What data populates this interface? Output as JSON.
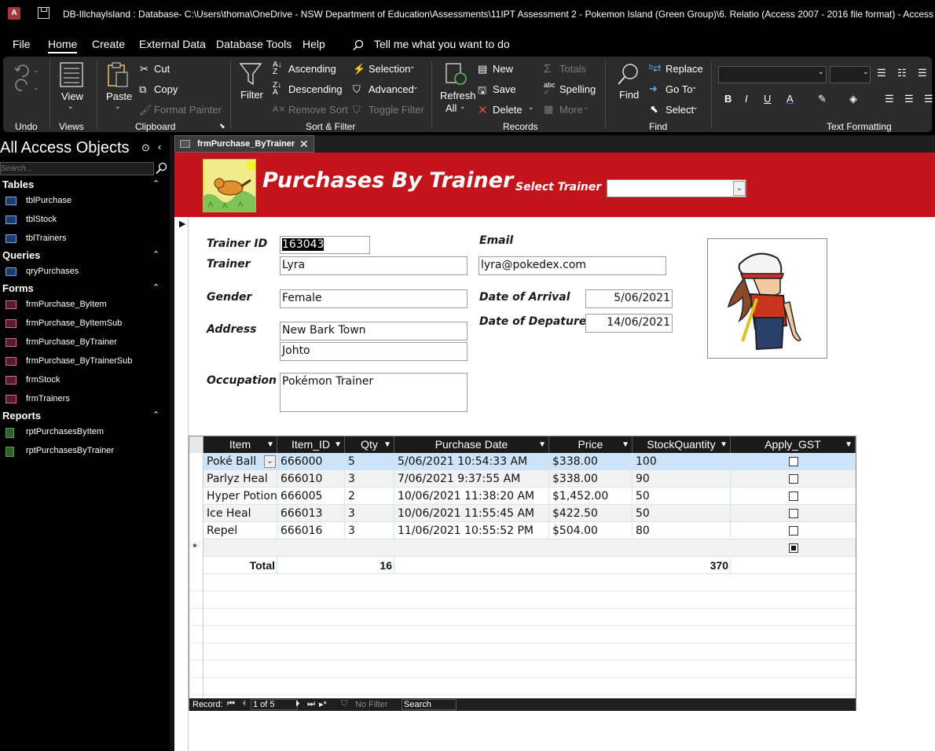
{
  "titlebar": {
    "title": "DB-Illchaylsland : Database- C:\\Users\\thoma\\OneDrive - NSW Department of Education\\Assessments\\11IPT Assessment 2 - Pokemon Island (Green Group)\\6. Relatio (Access 2007 - 2016 file format)  -  Access",
    "app_icon": "A"
  },
  "menu": [
    "File",
    "Home",
    "Create",
    "External Data",
    "Database Tools",
    "Help"
  ],
  "tell_me": "Tell me what you want to do",
  "ribbon": {
    "undo_group": "Undo",
    "views_group": "Views",
    "view_label": "View",
    "clipboard_group": "Clipboard",
    "paste": "Paste",
    "cut": "Cut",
    "copy": "Copy",
    "format_painter": "Format Painter",
    "sortfilter_group": "Sort & Filter",
    "filter": "Filter",
    "ascending": "Ascending",
    "descending": "Descending",
    "remove_sort": "Remove Sort",
    "selection": "Selection",
    "advanced": "Advanced",
    "toggle_filter": "Toggle Filter",
    "records_group": "Records",
    "refresh": "Refresh",
    "refresh2": "All",
    "new": "New",
    "save": "Save",
    "delete": "Delete",
    "totals": "Totals",
    "spelling": "Spelling",
    "more": "More",
    "find_group": "Find",
    "find": "Find",
    "replace": "Replace",
    "goto": "Go To",
    "select": "Select",
    "textfmt_group": "Text Formatting"
  },
  "nav": {
    "title": "All Access Objects",
    "search_placeholder": "Search...",
    "tables_label": "Tables",
    "tables": [
      "tblPurchase",
      "tblStock",
      "tblTrainers"
    ],
    "queries_label": "Queries",
    "queries": [
      "qryPurchases"
    ],
    "forms_label": "Forms",
    "forms": [
      "frmPurchase_ByItem",
      "frmPurchase_ByItemSub",
      "frmPurchase_ByTrainer",
      "frmPurchase_ByTrainerSub",
      "frmStock",
      "frmTrainers"
    ],
    "reports_label": "Reports",
    "reports": [
      "rptPurchasesByItem",
      "rptPurchasesByTrainer"
    ]
  },
  "doc_tab": "frmPurchase_ByTrainer",
  "form": {
    "title": "Purchases By Trainer",
    "select_trainer_label": "Select Trainer",
    "select_trainer_value": "",
    "trainer_id_label": "Trainer ID",
    "trainer_id": "163043",
    "trainer_label": "Trainer",
    "trainer": "Lyra",
    "gender_label": "Gender",
    "gender": "Female",
    "address_label": "Address",
    "address1": "New Bark Town",
    "address2": "Johto",
    "occupation_label": "Occupation",
    "occupation": "Pokémon Trainer",
    "email_label": "Email",
    "email": "lyra@pokedex.com",
    "arrival_label": "Date of Arrival",
    "arrival": "5/06/2021",
    "departure_label": "Date of Depature",
    "departure": "14/06/2021"
  },
  "grid": {
    "columns": [
      "Item",
      "Item_ID",
      "Qty",
      "Purchase Date",
      "Price",
      "StockQuantity",
      "Apply_GST"
    ],
    "rows": [
      {
        "item": "Poké Ball",
        "id": "666000",
        "qty": "5",
        "date": "5/06/2021 10:54:33 AM",
        "price": "$338.00",
        "stock": "100",
        "gst": false
      },
      {
        "item": "Parlyz Heal",
        "id": "666010",
        "qty": "3",
        "date": "7/06/2021 9:37:55 AM",
        "price": "$338.00",
        "stock": "90",
        "gst": false
      },
      {
        "item": "Hyper Potion",
        "id": "666005",
        "qty": "2",
        "date": "10/06/2021 11:38:20 AM",
        "price": "$1,452.00",
        "stock": "50",
        "gst": false
      },
      {
        "item": "Ice Heal",
        "id": "666013",
        "qty": "3",
        "date": "10/06/2021 11:55:45 AM",
        "price": "$422.50",
        "stock": "50",
        "gst": false
      },
      {
        "item": "Repel",
        "id": "666016",
        "qty": "3",
        "date": "11/06/2021 10:55:52 PM",
        "price": "$504.00",
        "stock": "80",
        "gst": false
      }
    ],
    "new_row_marker": "*",
    "total_label": "Total",
    "total_qty": "16",
    "total_stock": "370"
  },
  "recnav": {
    "label": "Record:",
    "position": "1 of 5",
    "filter": "No Filter",
    "search": "Search"
  }
}
